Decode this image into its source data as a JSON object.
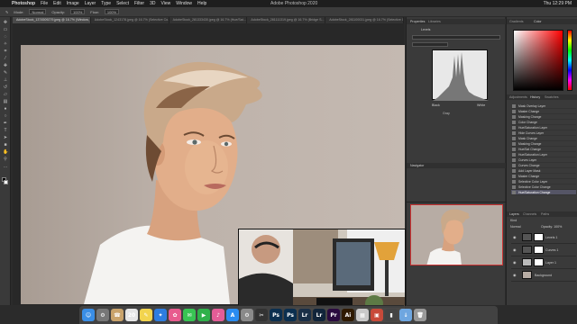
{
  "menubar": {
    "app_name": "Photoshop",
    "items": [
      "File",
      "Edit",
      "Image",
      "Layer",
      "Type",
      "Select",
      "Filter",
      "3D",
      "View",
      "Window",
      "Help"
    ],
    "window_title": "Adobe Photoshop 2020",
    "clock": "Thu 12:29 PM"
  },
  "options_bar": {
    "mode_label": "Mode:",
    "mode_value": "Normal",
    "opacity_label": "Opacity:",
    "opacity_value": "100%",
    "flow_label": "Flow:",
    "flow_value": "100%"
  },
  "tabs": [
    {
      "label": "AdobeStock_1374509279.jpeg @ 16.7% (Window, Layer Mask/8) *"
    },
    {
      "label": "AdobeStock_1243178.jpeg @ 16.7% (Selective Co..."
    },
    {
      "label": "AdobeStock_281333430.jpeg @ 16.7% (Hue/Sat..."
    },
    {
      "label": "AdobeStock_281111319.jpeg @ 16.7% (Bridge S..."
    },
    {
      "label": "AdobeStock_281100031.jpeg @ 16.7% (Selective Co..."
    }
  ],
  "panels": {
    "properties_tab": "Properties",
    "libraries_tab": "Libraries",
    "adjustment_label": "Levels",
    "navigator_tab": "Navigator",
    "histogram_btn_left": "Black",
    "histogram_btn_mid": "Gray",
    "histogram_btn_right": "White",
    "color_tab": "Color",
    "swatches_tab": "Swatches",
    "gradients_tab": "Gradients",
    "history_tab": "History",
    "adjustments_tab": "Adjustments",
    "layers_tab": "Layers",
    "channels_tab": "Channels",
    "paths_tab": "Paths",
    "kind_label": "Kind",
    "blend_label": "Normal",
    "opacity_label": "Opacity: 100%"
  },
  "history_items": [
    "Mask Overlay Layer",
    "Master Change",
    "Masking Change",
    "Color Change",
    "Hue/Saturation Layer",
    "Hide Curves Layer",
    "Mask Change",
    "Masking Change",
    "Hue/Sat Change",
    "Hue/Saturation Layer",
    "Curves Layer",
    "Curves Change",
    "Add Layer Mask",
    "Master Change",
    "Selective Color Layer",
    "Selective Color Change",
    "Hue/Saturation Change"
  ],
  "layers": [
    {
      "name": "Levels 1"
    },
    {
      "name": "Curves 1"
    },
    {
      "name": "Layer 1"
    },
    {
      "name": "Background"
    }
  ],
  "dock": [
    {
      "name": "finder-icon",
      "glyph": "☺",
      "color": "#3a8ee6"
    },
    {
      "name": "launchpad-icon",
      "glyph": "⚙",
      "color": "#777777"
    },
    {
      "name": "contacts-icon",
      "glyph": "☎",
      "color": "#c9a36b"
    },
    {
      "name": "calendar-icon",
      "glyph": "20",
      "color": "#e6e6e6"
    },
    {
      "name": "notes-icon",
      "glyph": "✎",
      "color": "#f2d44e"
    },
    {
      "name": "safari-icon",
      "glyph": "✦",
      "color": "#2e7de0"
    },
    {
      "name": "photos-icon",
      "glyph": "✿",
      "color": "#e85b8e"
    },
    {
      "name": "messages-icon",
      "glyph": "✉",
      "color": "#38c453"
    },
    {
      "name": "facetime-icon",
      "glyph": "▶",
      "color": "#2fb14a"
    },
    {
      "name": "itunes-icon",
      "glyph": "♪",
      "color": "#e35d97"
    },
    {
      "name": "appstore-icon",
      "glyph": "A",
      "color": "#2a8cf0"
    },
    {
      "name": "preferences-icon",
      "glyph": "⚙",
      "color": "#8a8a8a"
    },
    {
      "name": "finalcut-icon",
      "glyph": "✂",
      "color": "#333333"
    },
    {
      "name": "photoshop-icon",
      "glyph": "Ps",
      "color": "#0b2f4f"
    },
    {
      "name": "photoshop2-icon",
      "glyph": "Ps",
      "color": "#0b2f4f"
    },
    {
      "name": "bridge-icon",
      "glyph": "Lr",
      "color": "#1a2f47"
    },
    {
      "name": "lightroom-icon",
      "glyph": "Lr",
      "color": "#11243a"
    },
    {
      "name": "premiere-icon",
      "glyph": "Pr",
      "color": "#2a0b3f"
    },
    {
      "name": "illustrator-icon",
      "glyph": "Ai",
      "color": "#2f1a00"
    },
    {
      "name": "stickies-icon",
      "glyph": "▦",
      "color": "#c9c9c9"
    },
    {
      "name": "preview-icon",
      "glyph": "▣",
      "color": "#c84a3a"
    },
    {
      "name": "terminal-icon",
      "glyph": "▮",
      "color": "#444444"
    },
    {
      "name": "downloads-icon",
      "glyph": "↓",
      "color": "#6ea6e0"
    },
    {
      "name": "trash-icon",
      "glyph": "🗑",
      "color": "#999999"
    }
  ]
}
